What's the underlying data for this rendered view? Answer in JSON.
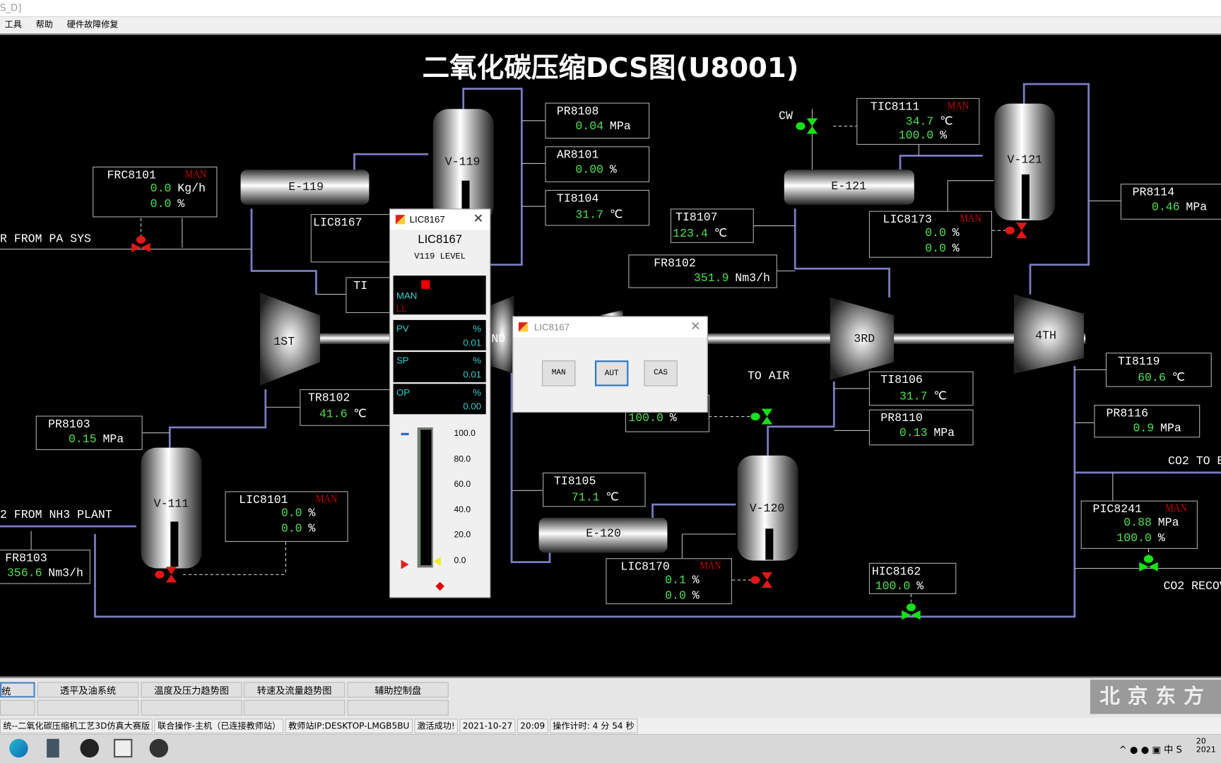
{
  "window": {
    "title": "S_D]",
    "menu": [
      "工具",
      "帮助",
      "硬件故障修复"
    ]
  },
  "page_title": "二氧化碳压缩DCS图(U8001)",
  "equipment": {
    "v119": "V-119",
    "v121": "V-121",
    "v111": "V-111",
    "v120": "V-120",
    "e119": "E-119",
    "e121": "E-121",
    "e120": "E-120",
    "c1": "1ST",
    "c2": "ND",
    "c3": "3RD",
    "c4": "4TH"
  },
  "labels": {
    "cw": "CW",
    "air_from_pa": "R FROM PA SYS",
    "co2_from_nh3": "2 FROM NH3 PLANT",
    "to_air": "TO AIR",
    "co2_to": "CO2 TO B",
    "co2_recov": "CO2 RECOV"
  },
  "tags": [
    {
      "name": "FRC8101",
      "mode": "MAN",
      "rows": [
        {
          "value": "0.0",
          "unit": "Kg/h"
        },
        {
          "value": "0.0",
          "unit": "%"
        }
      ]
    },
    {
      "name": "PR8108",
      "rows": [
        {
          "value": "0.04",
          "unit": "MPa"
        }
      ]
    },
    {
      "name": "AR8101",
      "rows": [
        {
          "value": "0.00",
          "unit": "%"
        }
      ]
    },
    {
      "name": "TI8104",
      "rows": [
        {
          "value": "31.7",
          "unit": "℃"
        }
      ]
    },
    {
      "name": "LIC8167",
      "rows": []
    },
    {
      "name": "TI",
      "rows": []
    },
    {
      "name": "TR8102",
      "rows": [
        {
          "value": "41.6",
          "unit": "℃"
        }
      ]
    },
    {
      "name": "PR8103",
      "rows": [
        {
          "value": "0.15",
          "unit": "MPa"
        }
      ]
    },
    {
      "name": "LIC8101",
      "mode": "MAN",
      "rows": [
        {
          "value": "0.0",
          "unit": "%"
        },
        {
          "value": "0.0",
          "unit": "%"
        }
      ]
    },
    {
      "name": "FR8103",
      "rows": [
        {
          "value": "356.6",
          "unit": "Nm3/h"
        }
      ]
    },
    {
      "name": "TI8107",
      "rows": [
        {
          "value": "123.4",
          "unit": "℃"
        }
      ]
    },
    {
      "name": "FR8102",
      "rows": [
        {
          "value": "351.9",
          "unit": "Nm3/h"
        }
      ]
    },
    {
      "name": "TIC8111",
      "mode": "MAN",
      "rows": [
        {
          "value": "34.7",
          "unit": "℃"
        },
        {
          "value": "100.0",
          "unit": "%"
        }
      ]
    },
    {
      "name": "LIC8173",
      "mode": "MAN",
      "rows": [
        {
          "value": "0.0",
          "unit": "%"
        },
        {
          "value": "0.0",
          "unit": "%"
        }
      ]
    },
    {
      "name": "PR8114",
      "rows": [
        {
          "value": "0.46",
          "unit": "MPa"
        }
      ]
    },
    {
      "name": "TI8106",
      "rows": [
        {
          "value": "31.7",
          "unit": "℃"
        }
      ]
    },
    {
      "name": "PR8110",
      "rows": [
        {
          "value": "0.13",
          "unit": "MPa"
        }
      ]
    },
    {
      "name": "",
      "rows": [
        {
          "value": "100.0",
          "unit": "%"
        }
      ]
    },
    {
      "name": "TI8119",
      "rows": [
        {
          "value": "60.6",
          "unit": "℃"
        }
      ]
    },
    {
      "name": "PR8116",
      "rows": [
        {
          "value": "0.9",
          "unit": "MPa"
        }
      ]
    },
    {
      "name": "PIC8241",
      "mode": "MAN",
      "rows": [
        {
          "value": "0.88",
          "unit": "MPa"
        },
        {
          "value": "100.0",
          "unit": "%"
        }
      ]
    },
    {
      "name": "HIC8162",
      "rows": [
        {
          "value": "100.0",
          "unit": "%"
        }
      ]
    },
    {
      "name": "TI8105",
      "rows": [
        {
          "value": "71.1",
          "unit": "℃"
        }
      ]
    },
    {
      "name": "LIC8170",
      "mode": "MAN",
      "rows": [
        {
          "value": "0.1",
          "unit": "%"
        },
        {
          "value": "0.0",
          "unit": "%"
        }
      ]
    }
  ],
  "faceplate": {
    "title": "LIC8167",
    "tag": "LIC8167",
    "desc": "V119 LEVEL",
    "mode": "MAN",
    "alarm": "LL",
    "pv_label": "PV",
    "pv": "0.01",
    "sp_label": "SP",
    "sp": "0.01",
    "op_label": "OP",
    "op": "0.00",
    "unit": "%",
    "scale": [
      "100.0",
      "80.0",
      "60.0",
      "40.0",
      "20.0",
      "0.0"
    ],
    "level_percent": 0.01
  },
  "mode_dialog": {
    "title": "LIC8167",
    "buttons": [
      "MAN",
      "AUT",
      "CAS"
    ],
    "focused": "AUT"
  },
  "bottom_tabs": [
    "统",
    "透平及油系统",
    "温度及压力趋势图",
    "转速及流量趋势图",
    "辅助控制盘"
  ],
  "logo": "北京东方",
  "status": [
    "统--二氧化碳压缩机工艺3D仿真大赛版",
    "联合操作-主机（已连接教师站）",
    "教师站IP:DESKTOP-LMGB5BU",
    "激活成功!",
    "2021-10-27",
    "20:09",
    "操作计时: 4 分 54 秒"
  ],
  "taskbar": {
    "icons": [
      "edge-icon",
      "calculator-icon",
      "obs-icon",
      "app-window-icon",
      "simulator-icon"
    ],
    "clock": "20 2021"
  },
  "colors": {
    "pipe": "#7c7cc0",
    "value": "#4ee04e",
    "alarm": "#c00000",
    "faceplate_text": "#33cccc"
  }
}
